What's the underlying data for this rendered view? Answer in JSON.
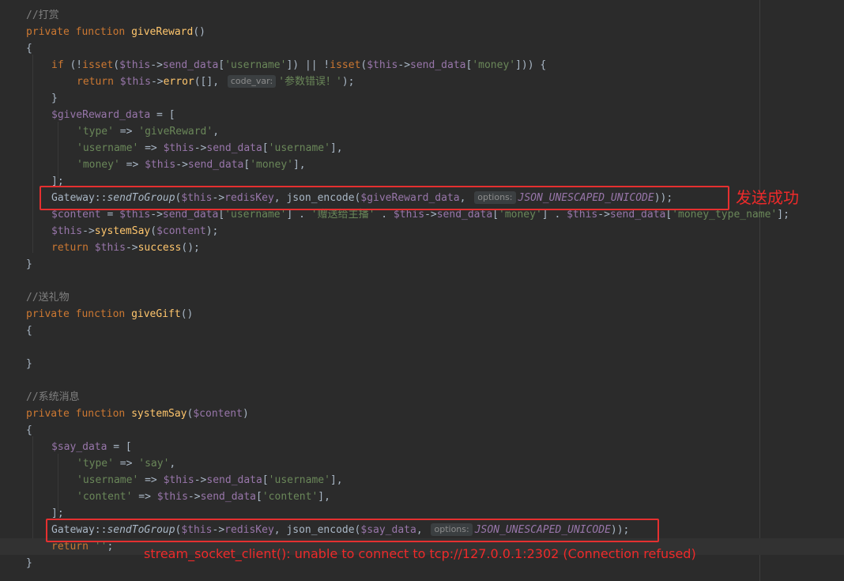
{
  "editor": {
    "hint_code_var": "code_var:",
    "hint_options": "options:",
    "lines": [
      {
        "segs": [
          [
            "c",
            "//打赏"
          ]
        ]
      },
      {
        "segs": [
          [
            "k",
            "private function "
          ],
          [
            "f",
            "giveReward"
          ],
          [
            "",
            "()"
          ]
        ]
      },
      {
        "segs": [
          [
            "",
            "{"
          ]
        ]
      },
      {
        "segs": [
          [
            "k",
            "if "
          ],
          [
            "",
            "(!"
          ],
          [
            "k",
            "isset"
          ],
          [
            "",
            "("
          ],
          [
            "v",
            "$this"
          ],
          [
            "",
            "->"
          ],
          [
            "v",
            "send_data"
          ],
          [
            "",
            "["
          ],
          [
            "s",
            "'username'"
          ],
          [
            "",
            "]) || !"
          ],
          [
            "k",
            "isset"
          ],
          [
            "",
            "("
          ],
          [
            "v",
            "$this"
          ],
          [
            "",
            "->"
          ],
          [
            "v",
            "send_data"
          ],
          [
            "",
            "["
          ],
          [
            "s",
            "'money'"
          ],
          [
            "",
            "])) {"
          ]
        ]
      },
      {
        "segs": [
          [
            "k",
            "return "
          ],
          [
            "v",
            "$this"
          ],
          [
            "",
            "->"
          ],
          [
            "f",
            "error"
          ],
          [
            "",
            "([], "
          ],
          [
            "hint",
            "code_var:"
          ],
          [
            "s",
            "'参数错误！'"
          ],
          [
            "",
            ");"
          ]
        ]
      },
      {
        "segs": [
          [
            "",
            "}"
          ]
        ]
      },
      {
        "segs": [
          [
            "v",
            "$giveReward_data"
          ],
          [
            "",
            " = ["
          ]
        ]
      },
      {
        "segs": [
          [
            "s",
            "'type'"
          ],
          [
            "",
            " => "
          ],
          [
            "s",
            "'giveReward'"
          ],
          [
            "",
            ","
          ]
        ]
      },
      {
        "segs": [
          [
            "s",
            "'username'"
          ],
          [
            "",
            " => "
          ],
          [
            "v",
            "$this"
          ],
          [
            "",
            "->"
          ],
          [
            "v",
            "send_data"
          ],
          [
            "",
            "["
          ],
          [
            "s",
            "'username'"
          ],
          [
            "",
            "],"
          ]
        ]
      },
      {
        "segs": [
          [
            "s",
            "'money'"
          ],
          [
            "",
            " => "
          ],
          [
            "v",
            "$this"
          ],
          [
            "",
            "->"
          ],
          [
            "v",
            "send_data"
          ],
          [
            "",
            "["
          ],
          [
            "s",
            "'money'"
          ],
          [
            "",
            "],"
          ]
        ]
      },
      {
        "segs": [
          [
            "",
            "];"
          ]
        ]
      },
      {
        "segs": [
          [
            "",
            "Gateway::"
          ],
          [
            "sf",
            "sendToGroup"
          ],
          [
            "",
            "("
          ],
          [
            "v",
            "$this"
          ],
          [
            "",
            "->"
          ],
          [
            "v",
            "redisKey"
          ],
          [
            "",
            ", json_encode("
          ],
          [
            "v",
            "$giveReward_data"
          ],
          [
            "",
            ", "
          ],
          [
            "hint",
            "options:"
          ],
          [
            "cs",
            "JSON_UNESCAPED_UNICODE"
          ],
          [
            "",
            "));"
          ]
        ]
      },
      {
        "segs": [
          [
            "v",
            "$content"
          ],
          [
            "",
            " = "
          ],
          [
            "v",
            "$this"
          ],
          [
            "",
            "->"
          ],
          [
            "v",
            "send_data"
          ],
          [
            "",
            "["
          ],
          [
            "s",
            "'username'"
          ],
          [
            "",
            "] . "
          ],
          [
            "s",
            "'赠送给主播'"
          ],
          [
            "",
            " . "
          ],
          [
            "v",
            "$this"
          ],
          [
            "",
            "->"
          ],
          [
            "v",
            "send_data"
          ],
          [
            "",
            "["
          ],
          [
            "s",
            "'money'"
          ],
          [
            "",
            "] . "
          ],
          [
            "v",
            "$this"
          ],
          [
            "",
            "->"
          ],
          [
            "v",
            "send_data"
          ],
          [
            "",
            "["
          ],
          [
            "s",
            "'money_type_name'"
          ],
          [
            "",
            "];"
          ]
        ]
      },
      {
        "segs": [
          [
            "v",
            "$this"
          ],
          [
            "",
            "->"
          ],
          [
            "f",
            "systemSay"
          ],
          [
            "",
            "("
          ],
          [
            "v",
            "$content"
          ],
          [
            "",
            ");"
          ]
        ]
      },
      {
        "segs": [
          [
            "k",
            "return "
          ],
          [
            "v",
            "$this"
          ],
          [
            "",
            "->"
          ],
          [
            "f",
            "success"
          ],
          [
            "",
            "();"
          ]
        ]
      },
      {
        "segs": [
          [
            "",
            "}"
          ]
        ]
      },
      {
        "segs": []
      },
      {
        "segs": [
          [
            "c",
            "//送礼物"
          ]
        ]
      },
      {
        "segs": [
          [
            "k",
            "private function "
          ],
          [
            "f",
            "giveGift"
          ],
          [
            "",
            "()"
          ]
        ]
      },
      {
        "segs": [
          [
            "",
            "{"
          ]
        ]
      },
      {
        "segs": []
      },
      {
        "segs": [
          [
            "",
            "}"
          ]
        ]
      },
      {
        "segs": []
      },
      {
        "segs": [
          [
            "c",
            "//系统消息"
          ]
        ]
      },
      {
        "segs": [
          [
            "k",
            "private function "
          ],
          [
            "f",
            "systemSay"
          ],
          [
            "",
            "("
          ],
          [
            "v",
            "$content"
          ],
          [
            "",
            ")"
          ]
        ]
      },
      {
        "segs": [
          [
            "",
            "{"
          ]
        ]
      },
      {
        "segs": [
          [
            "v",
            "$say_data"
          ],
          [
            "",
            " = ["
          ]
        ]
      },
      {
        "segs": [
          [
            "s",
            "'type'"
          ],
          [
            "",
            " => "
          ],
          [
            "s",
            "'say'"
          ],
          [
            "",
            ","
          ]
        ]
      },
      {
        "segs": [
          [
            "s",
            "'username'"
          ],
          [
            "",
            " => "
          ],
          [
            "v",
            "$this"
          ],
          [
            "",
            "->"
          ],
          [
            "v",
            "send_data"
          ],
          [
            "",
            "["
          ],
          [
            "s",
            "'username'"
          ],
          [
            "",
            "],"
          ]
        ]
      },
      {
        "segs": [
          [
            "s",
            "'content'"
          ],
          [
            "",
            " => "
          ],
          [
            "v",
            "$this"
          ],
          [
            "",
            "->"
          ],
          [
            "v",
            "send_data"
          ],
          [
            "",
            "["
          ],
          [
            "s",
            "'content'"
          ],
          [
            "",
            "],"
          ]
        ]
      },
      {
        "segs": [
          [
            "",
            "];"
          ]
        ]
      },
      {
        "segs": [
          [
            "",
            "Gateway::"
          ],
          [
            "sf",
            "sendToGroup"
          ],
          [
            "",
            "("
          ],
          [
            "v",
            "$this"
          ],
          [
            "",
            "->"
          ],
          [
            "v",
            "redisKey"
          ],
          [
            "",
            ", json_encode("
          ],
          [
            "v",
            "$say_data"
          ],
          [
            "",
            ", "
          ],
          [
            "hint",
            "options:"
          ],
          [
            "cs",
            "JSON_UNESCAPED_UNICODE"
          ],
          [
            "",
            "));"
          ]
        ]
      },
      {
        "segs": [
          [
            "k",
            "return "
          ],
          [
            "s",
            "''"
          ],
          [
            "",
            ";"
          ]
        ]
      },
      {
        "segs": [
          [
            "",
            "}"
          ]
        ]
      }
    ]
  },
  "annotations": {
    "success_note": "发送成功",
    "error_note": "stream_socket_client(): unable to connect to tcp://127.0.0.1:2302 (Connection refused)"
  },
  "colors": {
    "background": "#2b2b2b",
    "annotation_red": "#e53030",
    "keyword": "#cc7832",
    "string": "#6a8759",
    "variable": "#9876aa",
    "function": "#ffc66d",
    "comment": "#808080"
  }
}
